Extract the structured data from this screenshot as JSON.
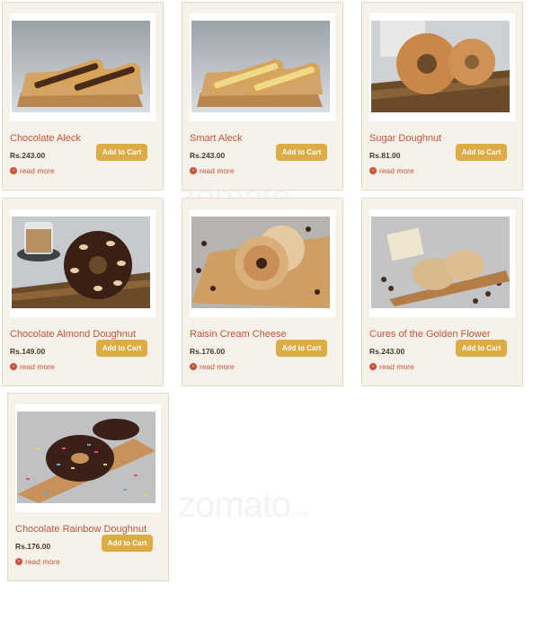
{
  "products": [
    {
      "name": "Chocolate Aleck",
      "price": "Rs.243.00",
      "cart_label": "Add to Cart",
      "more_label": "read more"
    },
    {
      "name": "Smart Aleck",
      "price": "Rs.243.00",
      "cart_label": "Add to Cart",
      "more_label": "read more"
    },
    {
      "name": "Sugar Doughnut",
      "price": "Rs.81.00",
      "cart_label": "Add to Cart",
      "more_label": "read more"
    },
    {
      "name": "Chocolate Almond Doughnut",
      "price": "Rs.149.00",
      "cart_label": "Add to Cart",
      "more_label": "read more"
    },
    {
      "name": "Raisin Cream Cheese",
      "price": "Rs.176.00",
      "cart_label": "Add to Cart",
      "more_label": "read more"
    },
    {
      "name": "Cures of the Golden Flower",
      "price": "Rs.243.00",
      "cart_label": "Add to Cart",
      "more_label": "read more"
    },
    {
      "name": "Chocolate Rainbow Doughnut",
      "price": "Rs.176.00",
      "cart_label": "Add to Cart",
      "more_label": "read more"
    }
  ],
  "watermark": {
    "text": "zomato",
    "suffix": ".com"
  },
  "colors": {
    "accent": "#dcad45",
    "link": "#c8533a",
    "card_bg": "#f6f2ea"
  }
}
